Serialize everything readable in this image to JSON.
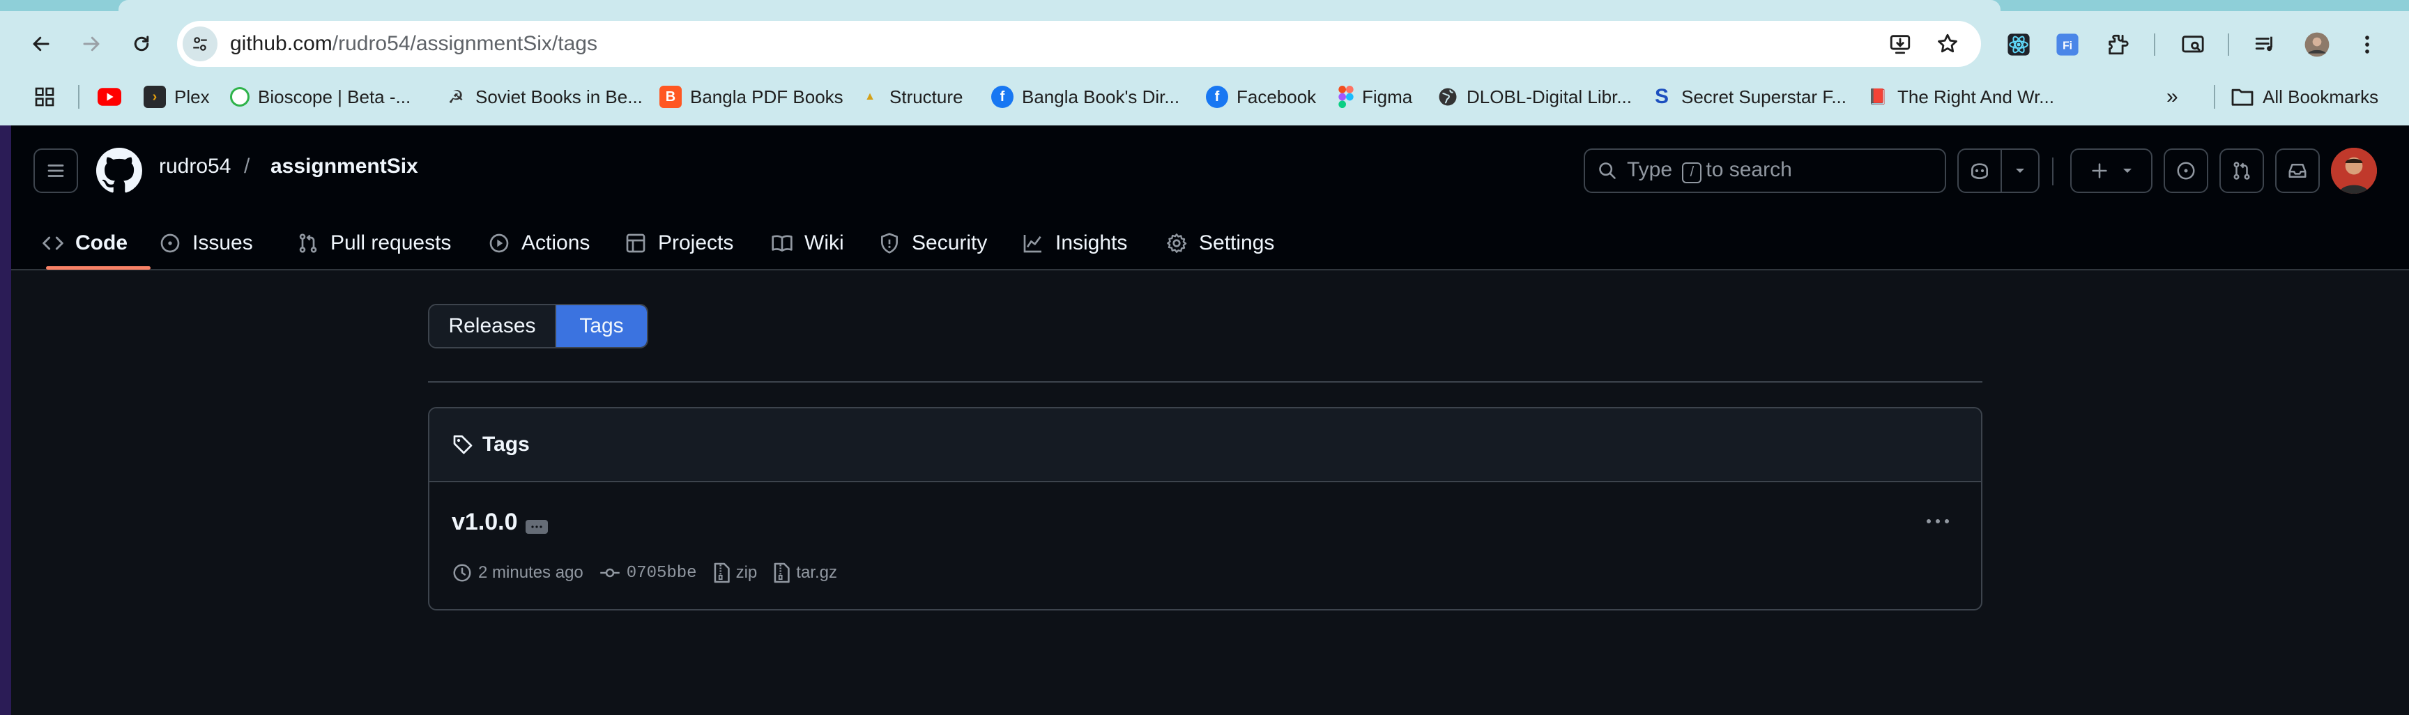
{
  "browser": {
    "url_host": "github.com",
    "url_path": "/rudro54/assignmentSix/tags",
    "bookmarks": [
      {
        "label": "",
        "icon": "youtube-icon",
        "color": "#ff0000"
      },
      {
        "label": "Plex",
        "icon": "plex-icon",
        "color": "#282a2d"
      },
      {
        "label": "Bioscope | Beta -...",
        "icon": "bioscope-icon",
        "color": "#2fb34a"
      },
      {
        "label": "Soviet Books in Be...",
        "icon": "soviet-books-icon",
        "color": "#333333"
      },
      {
        "label": "Bangla PDF Books",
        "icon": "blogger-icon",
        "color": "#ff5722"
      },
      {
        "label": "Structure",
        "icon": "pma-icon",
        "color": "#d4a017"
      },
      {
        "label": "Bangla Book's Dir...",
        "icon": "facebook-icon",
        "color": "#1877f2"
      },
      {
        "label": "Facebook",
        "icon": "facebook-icon",
        "color": "#1877f2"
      },
      {
        "label": "Figma",
        "icon": "figma-icon",
        "color": "#a259ff"
      },
      {
        "label": "DLOBL-Digital Libr...",
        "icon": "globe-icon",
        "color": "#333333"
      },
      {
        "label": "Secret Superstar F...",
        "icon": "s-icon",
        "color": "#1c4fbf"
      },
      {
        "label": "The Right And Wr...",
        "icon": "book-icon",
        "color": "#555555"
      }
    ],
    "all_bookmarks_label": "All Bookmarks"
  },
  "github": {
    "owner": "rudro54",
    "separator": "/",
    "repo": "assignmentSix",
    "search_prefix": "Type",
    "search_slash": "/",
    "search_suffix": "to search",
    "tabs": [
      {
        "label": "Code",
        "icon": "code-icon",
        "active": true
      },
      {
        "label": "Issues",
        "icon": "issue-icon",
        "active": false
      },
      {
        "label": "Pull requests",
        "icon": "pull-request-icon",
        "active": false
      },
      {
        "label": "Actions",
        "icon": "play-icon",
        "active": false
      },
      {
        "label": "Projects",
        "icon": "table-icon",
        "active": false
      },
      {
        "label": "Wiki",
        "icon": "book-icon",
        "active": false
      },
      {
        "label": "Security",
        "icon": "shield-icon",
        "active": false
      },
      {
        "label": "Insights",
        "icon": "graph-icon",
        "active": false
      },
      {
        "label": "Settings",
        "icon": "gear-icon",
        "active": false
      }
    ],
    "toggle": {
      "releases": "Releases",
      "tags": "Tags",
      "selected": "Tags"
    },
    "tags_box": {
      "title": "Tags",
      "tag": {
        "name": "v1.0.0",
        "time": "2 minutes ago",
        "commit": "0705bbe",
        "zip": "zip",
        "tar": "tar.gz"
      }
    },
    "colors": {
      "accent": "#3b73e0",
      "underline": "#f78166",
      "background": "#0d1117"
    }
  }
}
